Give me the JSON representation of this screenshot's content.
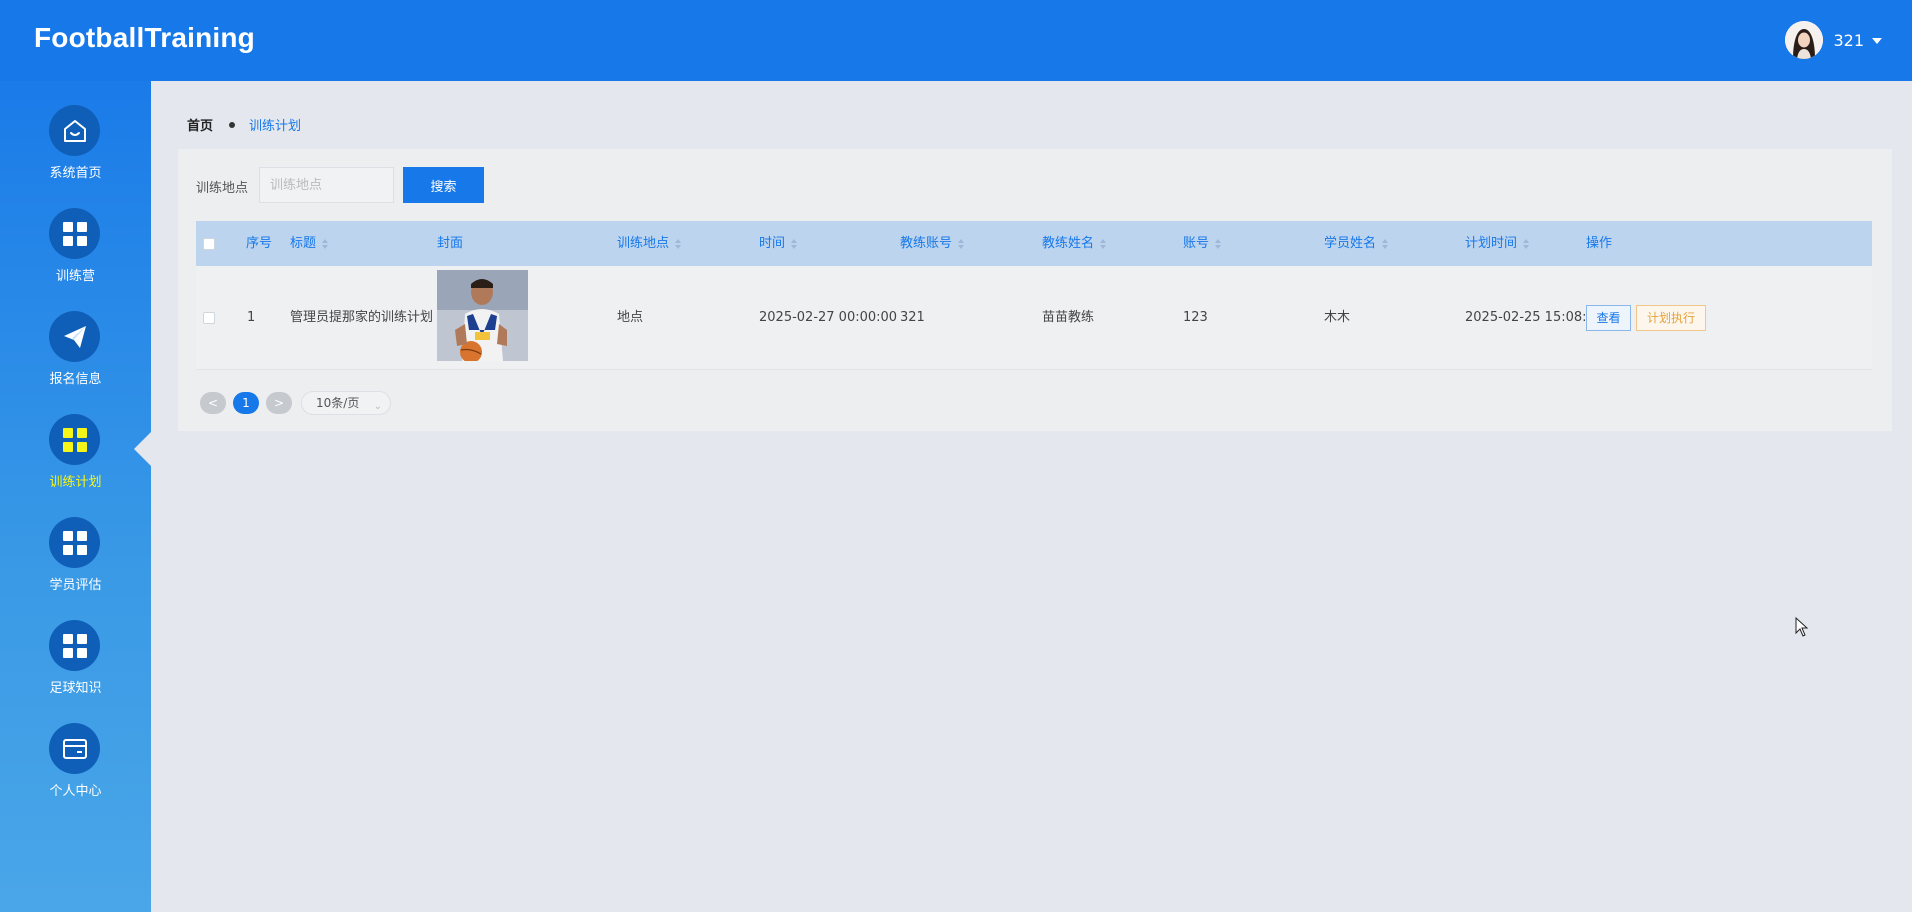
{
  "header": {
    "brand": "FootballTraining",
    "user_name": "321"
  },
  "sidebar": {
    "items": [
      {
        "label": "系统首页",
        "icon": "home-icon"
      },
      {
        "label": "训练营",
        "icon": "grid-icon"
      },
      {
        "label": "报名信息",
        "icon": "paper-plane-icon"
      },
      {
        "label": "训练计划",
        "icon": "grid-icon",
        "active": true
      },
      {
        "label": "学员评估",
        "icon": "grid-icon"
      },
      {
        "label": "足球知识",
        "icon": "grid-icon"
      },
      {
        "label": "个人中心",
        "icon": "card-icon"
      }
    ],
    "active_color": "#f5f51a"
  },
  "breadcrumb": {
    "home": "首页",
    "current": "训练计划"
  },
  "search": {
    "label": "训练地点",
    "placeholder": "训练地点",
    "button": "搜索"
  },
  "table": {
    "columns": [
      "序号",
      "标题",
      "封面",
      "训练地点",
      "时间",
      "教练账号",
      "教练姓名",
      "账号",
      "学员姓名",
      "计划时间",
      "操作"
    ],
    "rows": [
      {
        "index": "1",
        "title": "管理员提那家的训练计划",
        "location": "地点",
        "time": "2025-02-27 00:00:00",
        "coach_account": "321",
        "coach_name": "苗苗教练",
        "account": "123",
        "student_name": "木木",
        "plan_time": "2025-02-25 15:08:08",
        "view_label": "查看",
        "exec_label": "计划执行"
      }
    ]
  },
  "pagination": {
    "prev": "<",
    "current_page": "1",
    "next": ">",
    "page_size": "10条/页"
  },
  "colors": {
    "primary": "#1778e9",
    "header_bg": "#1778e9",
    "table_header_bg": "#bcd4ee",
    "warning": "#e6a23c"
  }
}
